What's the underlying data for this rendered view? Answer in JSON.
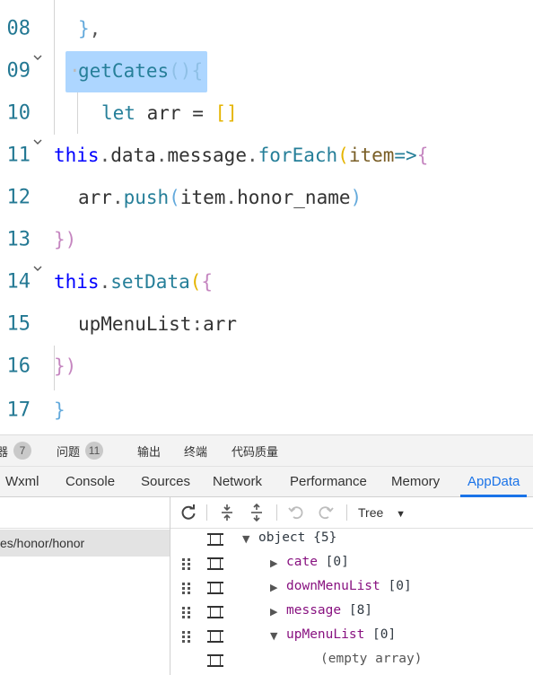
{
  "editor": {
    "lines": [
      {
        "num": "08",
        "fold": false
      },
      {
        "num": "09",
        "fold": true
      },
      {
        "num": "10",
        "fold": false
      },
      {
        "num": "11",
        "fold": true
      },
      {
        "num": "12",
        "fold": false
      },
      {
        "num": "13",
        "fold": false
      },
      {
        "num": "14",
        "fold": true
      },
      {
        "num": "15",
        "fold": false
      },
      {
        "num": "16",
        "fold": false
      },
      {
        "num": "17",
        "fold": false
      }
    ],
    "tokens": {
      "l08": {
        "brace": "}",
        "comma": ","
      },
      "l09": {
        "fn": "getCates",
        "parens": "()",
        "brace": "{"
      },
      "l10": {
        "kw": "let",
        "name": "arr",
        "eq": "=",
        "arr": "[]"
      },
      "l11": {
        "this": "this",
        "d1": ".",
        "data": "data",
        "d2": ".",
        "message": "message",
        "d3": ".",
        "fe": "forEach",
        "p1": "(",
        "item": "item",
        "arrow": "=>",
        "b1": "{"
      },
      "l12": {
        "arr": "arr",
        "d1": ".",
        "push": "push",
        "p1": "(",
        "item": "item",
        "d2": ".",
        "prop": "honor_name",
        "p2": ")"
      },
      "l13": {
        "close": "})"
      },
      "l14": {
        "this": "this",
        "d1": ".",
        "fn": "setData",
        "p1": "(",
        "b1": "{"
      },
      "l15": {
        "key": "upMenuList",
        "colon": ":",
        "val": "arr"
      },
      "l16": {
        "close": "})"
      },
      "l17": {
        "brace": "}"
      }
    }
  },
  "devtools": {
    "panel_tabs": [
      {
        "label": "器",
        "badge": "7"
      },
      {
        "label": "问题",
        "badge": "11"
      },
      {
        "label": "输出"
      },
      {
        "label": "终端"
      },
      {
        "label": "代码质量"
      }
    ],
    "tool_tabs": [
      "Wxml",
      "Console",
      "Sources",
      "Network",
      "Performance",
      "Memory",
      "AppData"
    ],
    "active_tool_tab": "AppData",
    "page_path": "es/honor/honor",
    "toolbar": {
      "icons": [
        "refresh-icon",
        "expand-all-icon",
        "collapse-all-icon",
        "undo-icon",
        "redo-icon"
      ],
      "view_mode": "Tree"
    },
    "tree": {
      "root": {
        "key": "object",
        "count": "{5}"
      },
      "rows": [
        {
          "key": "cate",
          "value": "[0]",
          "expanded": false
        },
        {
          "key": "downMenuList",
          "value": "[0]",
          "expanded": false
        },
        {
          "key": "message",
          "value": "[8]",
          "expanded": false
        },
        {
          "key": "upMenuList",
          "value": "[0]",
          "expanded": true
        }
      ],
      "empty_text": "(empty array)"
    }
  },
  "colors": {
    "accent": "#1a73e8",
    "line_number": "#237893",
    "selection": "#add6ff",
    "tree_key": "#881280"
  }
}
